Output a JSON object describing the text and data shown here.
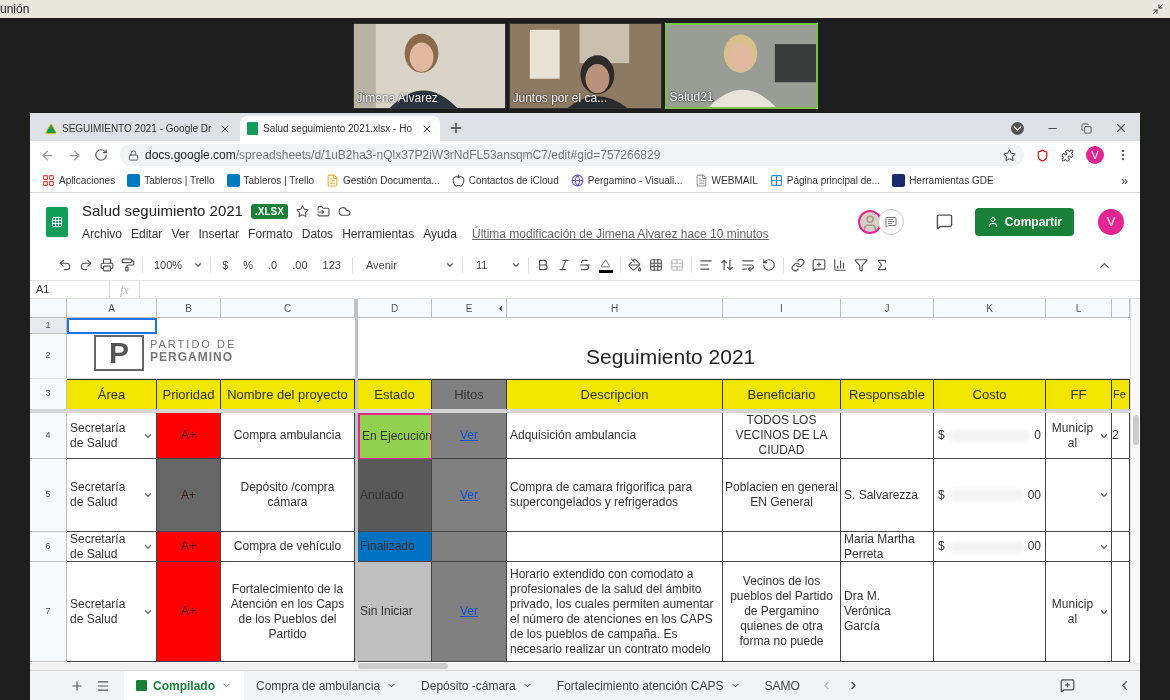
{
  "top_bar": {
    "title": "unión"
  },
  "participants": [
    {
      "name": "Jimena Alvarez",
      "speaking": false
    },
    {
      "name": "Juntos por el ca...",
      "speaking": false
    },
    {
      "name": "Salud21",
      "speaking": true
    }
  ],
  "browser": {
    "tabs": [
      {
        "title": "SEGUIMIENTO 2021 - Google Dr",
        "selected": false,
        "kind": "drive"
      },
      {
        "title": "Salud seguimiento 2021.xlsx - Ho",
        "selected": true,
        "kind": "sheets"
      }
    ],
    "url_host": "docs.google.com",
    "url_path": "/spreadsheets/d/1uB2ha3-nQlx37P2iW3rNdFL53ansqmC7/edit#gid=757266829",
    "profile": "V",
    "bookmarks": [
      {
        "label": "Aplicaciones",
        "kind": "apps"
      },
      {
        "label": "Tableros | Trello",
        "kind": "trello"
      },
      {
        "label": "Tableros | Trello",
        "kind": "trello"
      },
      {
        "label": "Gestión Documenta...",
        "kind": "doc"
      },
      {
        "label": "Contactos de iCloud",
        "kind": "apple"
      },
      {
        "label": "Pergamino - Visuali...",
        "kind": "globe"
      },
      {
        "label": "WEBMAIL",
        "kind": "page"
      },
      {
        "label": "Página principal de...",
        "kind": "windows"
      },
      {
        "label": "Herramientas GDE",
        "kind": "gde"
      }
    ],
    "more": "»"
  },
  "doc": {
    "title": "Salud seguimiento 2021",
    "badge": ".XLSX",
    "menu": [
      "Archivo",
      "Editar",
      "Ver",
      "Insertar",
      "Formato",
      "Datos",
      "Herramientas",
      "Ayuda"
    ],
    "last_edit": "Última modificación de Jimena Alvarez hace 10 minutos",
    "share": "Compartir",
    "avatar": "V"
  },
  "toolbar": {
    "zoom": "100%",
    "currency": "$",
    "percent": "%",
    "dec_minus": ".0",
    "dec_plus": ".00",
    "number_format": "123",
    "font": "Avenir",
    "size": "11"
  },
  "formula_bar": {
    "cell": "A1",
    "fx": "fx"
  },
  "sheet": {
    "column_letters": [
      "A",
      "B",
      "C",
      "D",
      "E",
      "H",
      "I",
      "J",
      "K",
      "L"
    ],
    "row_numbers": [
      "1",
      "2",
      "3",
      "4",
      "5",
      "6",
      "7"
    ],
    "logo": {
      "letter": "P",
      "line1": "PARTIDO DE",
      "line2": "PERGAMINO"
    },
    "title": "Seguimiento 2021",
    "headers": [
      {
        "label": "Área",
        "color": "#f2e600"
      },
      {
        "label": "Prioridad",
        "color": "#f2e600"
      },
      {
        "label": "Nombre del proyecto",
        "color": "#f2e600"
      },
      {
        "label": "Estado",
        "color": "#f2e600"
      },
      {
        "label": "Hitos",
        "color": "#808080"
      },
      {
        "label": "Descripcion",
        "color": "#f2e600"
      },
      {
        "label": "Beneficiario",
        "color": "#f2e600"
      },
      {
        "label": "Responsable",
        "color": "#f2e600"
      },
      {
        "label": "Costo",
        "color": "#f2e600"
      },
      {
        "label": "FF",
        "color": "#f2e600"
      },
      {
        "label": "Fe",
        "color": "#f2e600"
      }
    ],
    "rows": [
      {
        "area": "Secretaría de Salud",
        "priority": {
          "text": "A+",
          "color": "#ff0000"
        },
        "project": "Compra ambulancia",
        "estado": {
          "text": "En Ejecución",
          "color": "#92d050",
          "collaborator_cursor": true
        },
        "hitos": "Ver",
        "descripcion": "Adquisición ambulancia",
        "beneficiario": "TODOS LOS VECINOS DE LA CIUDAD",
        "responsable": "",
        "costo": {
          "currency": "$",
          "tail": "0"
        },
        "ff": "Municip al",
        "column_13": "2"
      },
      {
        "area": "Secretaría de Salud",
        "priority": {
          "text": "A+",
          "color": "#666666"
        },
        "project": "Depósito /compra cámara",
        "estado": {
          "text": "Anulado",
          "color": "#595959",
          "collaborator_cursor": false
        },
        "hitos": "Ver",
        "descripcion": "Compra de camara frigorifica para supercongelados y refrigerados",
        "beneficiario": "Poblacien en general EN General",
        "responsable": "S. Salvarezza",
        "costo": {
          "currency": "$",
          "tail": "00"
        },
        "ff": "",
        "column_13": ""
      },
      {
        "area": "Secretaría de Salud",
        "priority": {
          "text": "A+",
          "color": "#ff0000"
        },
        "project": "Compra de vehículo",
        "estado": {
          "text": "Finalizado",
          "color": "#0070c0",
          "collaborator_cursor": false
        },
        "hitos": "",
        "descripcion": "",
        "beneficiario": "",
        "responsable": "Maria Martha Perreta",
        "costo": {
          "currency": "$",
          "tail": "00"
        },
        "ff": "",
        "column_13": ""
      },
      {
        "area": "Secretaría de Salud",
        "priority": {
          "text": "A+",
          "color": "#ff0000"
        },
        "project": "Fortalecimiento de la Atención en los Caps de los Pueblos del Partido",
        "estado": {
          "text": "Sin Iniciar",
          "color": "#bfbfbf",
          "collaborator_cursor": false
        },
        "hitos": "Ver",
        "descripcion": "Horario extendido con comodato a profesionales de la salud del ámbito privado, los cuales permiten aumentar el número de atenciones en los CAPS de los pueblos de campaña. Es necesario realizar un contrato modelo",
        "beneficiario": "Vecinos de los pueblos del Partido de Pergamino quienes de otra forma no puede",
        "responsable": "Dra M. Verónica García",
        "costo": null,
        "ff": "Municip al",
        "column_13": ""
      }
    ]
  },
  "sheet_tabs": [
    {
      "label": "Compilado",
      "selected": true
    },
    {
      "label": "Compra de ambulancia",
      "selected": false
    },
    {
      "label": "Depósito -cámara",
      "selected": false
    },
    {
      "label": "Fortalecimiento atención CAPS",
      "selected": false
    },
    {
      "label": "SAMO",
      "selected": false
    }
  ]
}
